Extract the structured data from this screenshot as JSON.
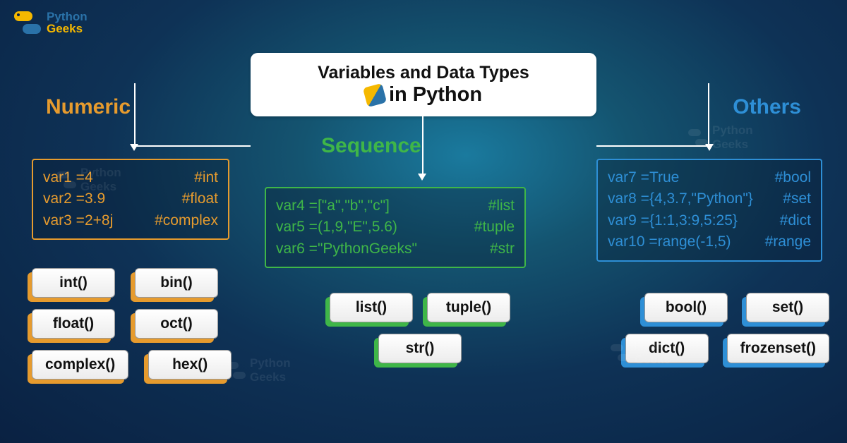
{
  "logo": {
    "line1": "Python",
    "line2": "Geeks"
  },
  "title": {
    "line1": "Variables and Data Types",
    "line2": "in Python"
  },
  "columns": {
    "numeric": {
      "title": "Numeric",
      "code": [
        {
          "assign": "var1 =4",
          "comment": "#int"
        },
        {
          "assign": "var2 =3.9",
          "comment": "#float"
        },
        {
          "assign": "var3 =2+8j",
          "comment": "#complex"
        }
      ],
      "buttons": [
        "int()",
        "bin()",
        "float()",
        "oct()",
        "complex()",
        "hex()"
      ]
    },
    "sequence": {
      "title": "Sequence",
      "code": [
        {
          "assign": "var4 =[\"a\",\"b\",\"c\"]",
          "comment": "#list"
        },
        {
          "assign": "var5 =(1,9,\"E\",5.6)",
          "comment": "#tuple"
        },
        {
          "assign": "var6 =\"PythonGeeks\"",
          "comment": "#str"
        }
      ],
      "buttons": [
        "list()",
        "tuple()",
        "str()"
      ]
    },
    "others": {
      "title": "Others",
      "code": [
        {
          "assign": "var7 =True",
          "comment": "#bool"
        },
        {
          "assign": "var8 ={4,3.7,\"Python\"}",
          "comment": "#set"
        },
        {
          "assign": "var9 ={1:1,3:9,5:25}",
          "comment": "#dict"
        },
        {
          "assign": "var10 =range(-1,5)",
          "comment": "#range"
        }
      ],
      "buttons": [
        "bool()",
        "set()",
        "dict()",
        "frozenset()"
      ]
    }
  }
}
